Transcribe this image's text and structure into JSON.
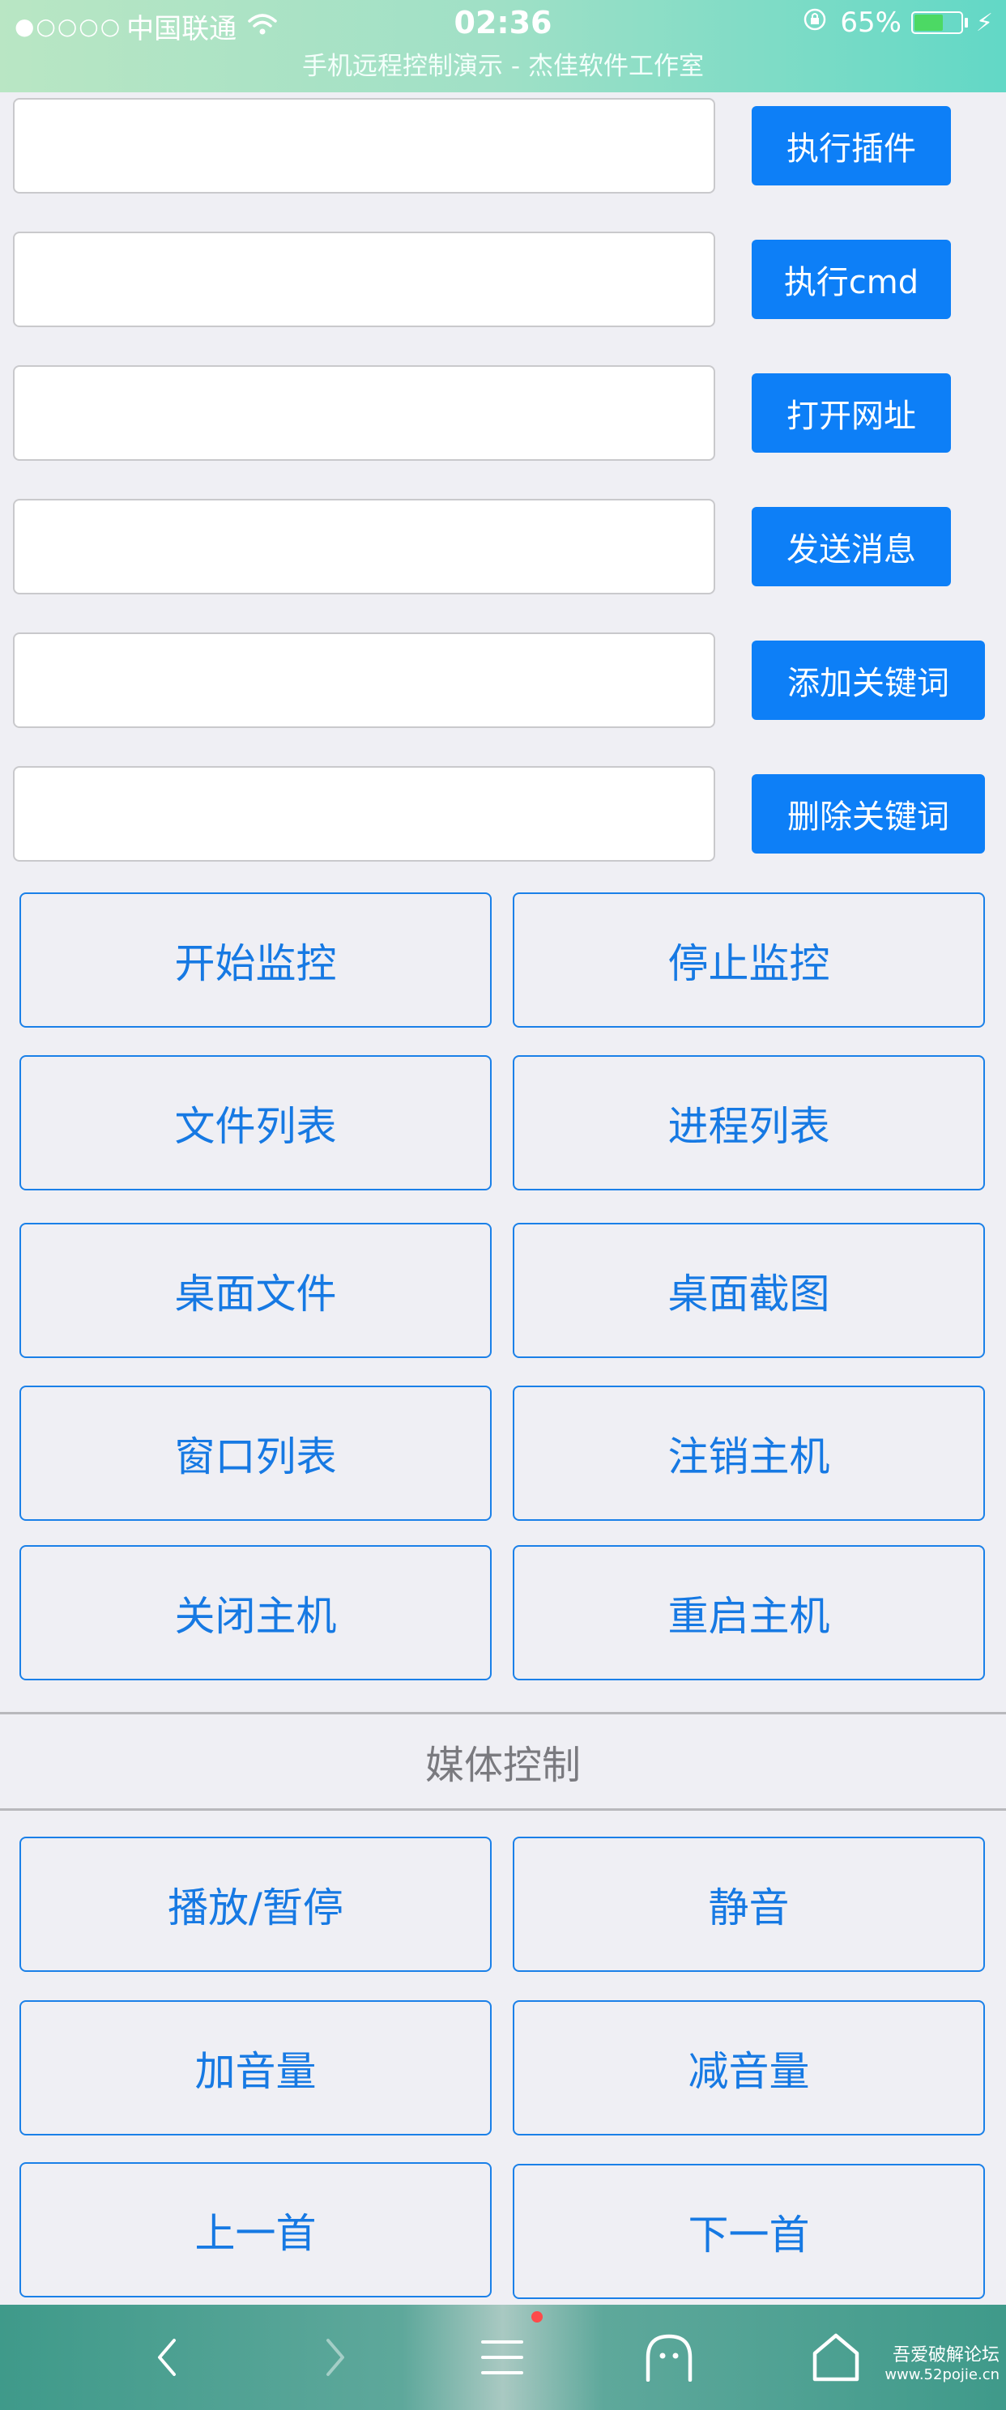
{
  "status_bar": {
    "signal": "●○○○○",
    "carrier": "中国联通",
    "time": "02:36",
    "battery": "65%",
    "battery_level": 0.65,
    "page_title": "手机远程控制演示 - 杰佳软件工作室"
  },
  "inputs": [
    {
      "value": "",
      "button": "执行插件"
    },
    {
      "value": "",
      "button": "执行cmd"
    },
    {
      "value": "",
      "button": "打开网址"
    },
    {
      "value": "",
      "button": "发送消息"
    },
    {
      "value": "",
      "button": "添加关键词"
    },
    {
      "value": "",
      "button": "删除关键词"
    }
  ],
  "controls": [
    "开始监控",
    "停止监控",
    "文件列表",
    "进程列表",
    "桌面文件",
    "桌面截图",
    "窗口列表",
    "注销主机",
    "关闭主机",
    "重启主机"
  ],
  "media_section": "媒体控制",
  "media": [
    "播放/暂停",
    "静音",
    "加音量",
    "减音量",
    "上一首",
    "下一首"
  ],
  "bottom_bar": {
    "icons": [
      "back-icon",
      "forward-icon",
      "menu-icon",
      "ghost-icon",
      "home-icon"
    ]
  },
  "watermark": {
    "line1": "吾爱破解论坛",
    "line2": "www.52pojie.cn"
  },
  "colors": {
    "accent": "#0d7ff7",
    "button_text": "#1679e3",
    "background": "#efeff4"
  }
}
